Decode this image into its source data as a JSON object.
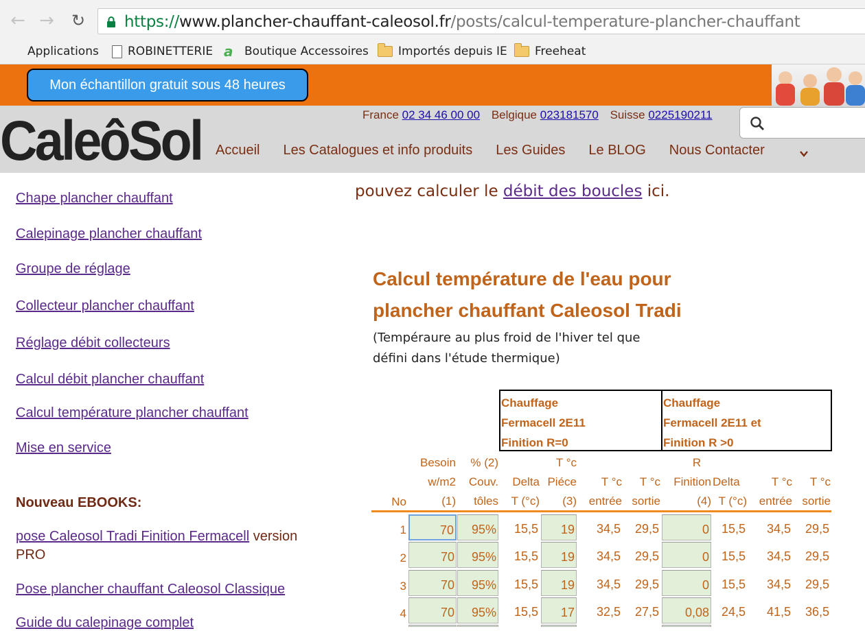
{
  "browser": {
    "url_scheme": "https://",
    "url_host": "www.plancher-chauffant-caleosol.fr",
    "url_path": "/posts/calcul-temperature-plancher-chauffant",
    "bookmarks": [
      "Applications",
      "ROBINETTERIE",
      "Boutique Accessoires",
      "Importés depuis IE",
      "Freeheat"
    ]
  },
  "banner": {
    "sample_button": "Mon échantillon gratuit sous 48 heures"
  },
  "header": {
    "logo": "CaleôSol",
    "phone_france_label": "France",
    "phone_france": "02 34 46 00 00",
    "phone_belgique_label": "Belgique",
    "phone_belgique": "023181570",
    "phone_suisse_label": "Suisse",
    "phone_suisse": "0225190211",
    "nav": [
      "Accueil",
      "Les Catalogues et info produits",
      "Les Guides",
      "Le BLOG",
      "Nous Contacter"
    ]
  },
  "sidebar": {
    "links": [
      "Chape plancher chauffant",
      "Calepinage plancher chauffant",
      "Groupe de réglage",
      "Collecteur plancher chauffant",
      "Réglage débit collecteurs",
      "Calcul débit plancher chauffant",
      "Calcul température plancher chauffant",
      "Mise en service"
    ],
    "ebooks_heading": "Nouveau EBOOKS:",
    "ebook1_link": "pose Caleosol Tradi Finition Fermacell",
    "ebook1_suffix": " version",
    "ebook1_suffix2": "PRO",
    "ebook2_link": "Pose plancher chauffant Caleosol Classique",
    "ebook3_link": "Guide du calepinage complet"
  },
  "main": {
    "intro_before": "pouvez calculer le ",
    "intro_link": "débit des boucles",
    "intro_after": " ici.",
    "title_line1": "Calcul température de l'eau pour",
    "title_line2": "plancher chauffant Caleosol Tradi",
    "subtitle_line1": "(Tempéraure au plus froid de l'hiver tel que",
    "subtitle_line2": "défini dans l'étude thermique)",
    "group1": [
      "Chauffage",
      "Fermacell 2E11",
      "Finition R=0"
    ],
    "group2": [
      "Chauffage",
      "Fermacell 2E11 et",
      "Finition R >0"
    ],
    "headers": {
      "no": "No",
      "besoin": [
        "Besoin",
        "w/m2",
        "(1)"
      ],
      "couv": [
        "% (2)",
        "Couv.",
        "tôles"
      ],
      "delta1": [
        "Delta",
        "T (°c)"
      ],
      "tpiece": [
        "T °c",
        "Piéce",
        "(3)"
      ],
      "tentree1": [
        "T °c",
        "entrée"
      ],
      "tsortie1": [
        "T °c",
        "sortie"
      ],
      "rfinition": [
        "R",
        "Finition",
        "(4)"
      ],
      "delta2": [
        "Delta",
        "T (°c)"
      ],
      "tentree2": [
        "T °c",
        "entrée"
      ],
      "tsortie2": [
        "T °c",
        "sortie"
      ]
    },
    "rows": [
      {
        "no": "1",
        "besoin": "70",
        "couv": "95%",
        "delta1": "15,5",
        "tpiece": "19",
        "te1": "34,5",
        "ts1": "29,5",
        "r": "0",
        "delta2": "15,5",
        "te2": "34,5",
        "ts2": "29,5"
      },
      {
        "no": "2",
        "besoin": "70",
        "couv": "95%",
        "delta1": "15,5",
        "tpiece": "19",
        "te1": "34,5",
        "ts1": "29,5",
        "r": "0",
        "delta2": "15,5",
        "te2": "34,5",
        "ts2": "29,5"
      },
      {
        "no": "3",
        "besoin": "70",
        "couv": "95%",
        "delta1": "15,5",
        "tpiece": "19",
        "te1": "34,5",
        "ts1": "29,5",
        "r": "0",
        "delta2": "15,5",
        "te2": "34,5",
        "ts2": "29,5"
      },
      {
        "no": "4",
        "besoin": "70",
        "couv": "95%",
        "delta1": "15,5",
        "tpiece": "17",
        "te1": "32,5",
        "ts1": "27,5",
        "r": "0,08",
        "delta2": "24,5",
        "te2": "41,5",
        "ts2": "36,5"
      }
    ]
  }
}
